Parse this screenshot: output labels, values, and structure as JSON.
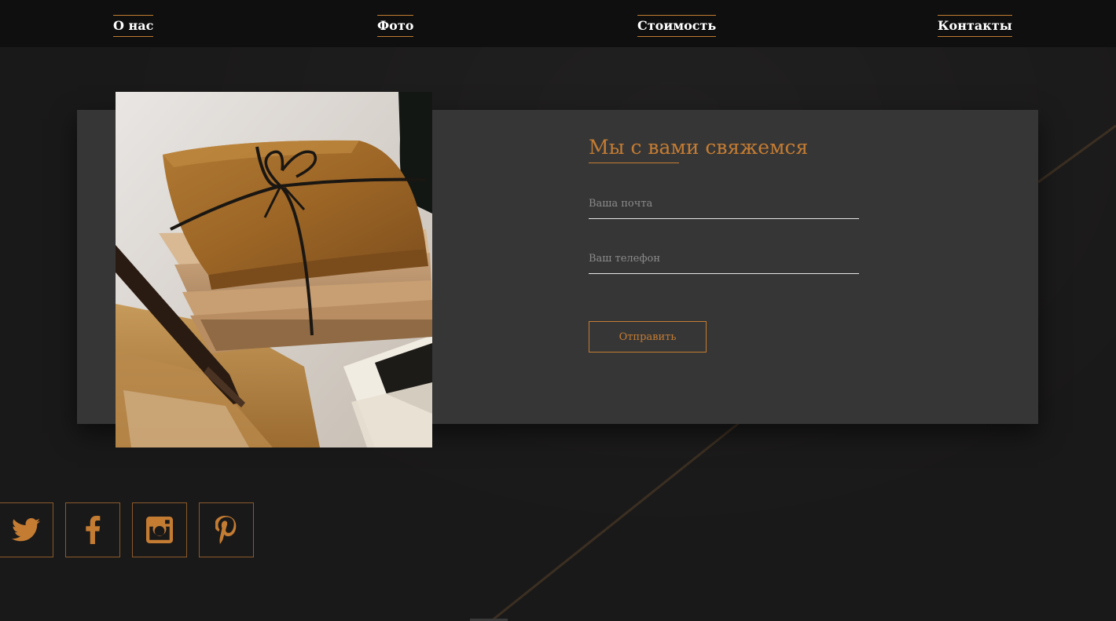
{
  "nav": {
    "items": [
      {
        "label": "О нас"
      },
      {
        "label": "Фото"
      },
      {
        "label": "Стоимость"
      },
      {
        "label": "Контакты"
      }
    ]
  },
  "contact_form": {
    "title": "Мы с вами свяжемся",
    "email_placeholder": "Ваша почта",
    "email_value": "",
    "phone_placeholder": "Ваш телефон",
    "phone_value": "",
    "submit_label": "Отправить"
  },
  "social": {
    "icons": [
      "twitter-icon",
      "facebook-icon",
      "instagram-icon",
      "pinterest-icon"
    ]
  },
  "colors": {
    "accent": "#c47c33",
    "background": "#1a1919",
    "nav_background": "#0f0f0f",
    "panel": "#363636",
    "nav_text": "#ffffff"
  }
}
